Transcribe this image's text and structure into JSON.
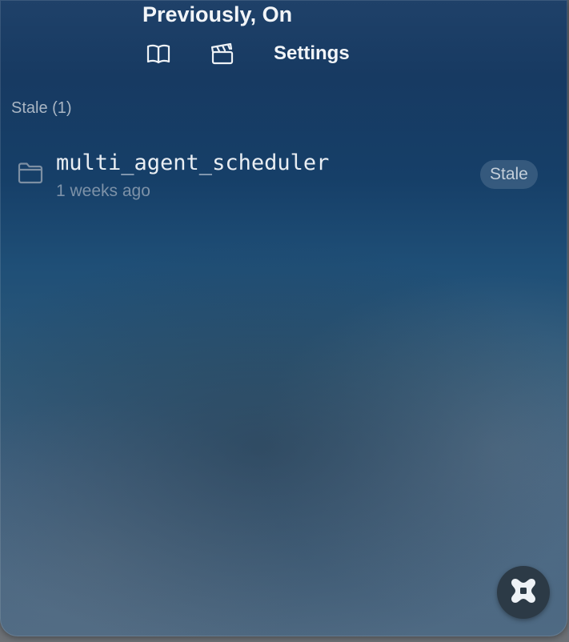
{
  "header": {
    "title": "Previously, On",
    "toolbar": {
      "book_icon": "book-open-icon",
      "clapper_icon": "clapperboard-icon",
      "settings_label": "Settings"
    }
  },
  "section": {
    "label": "Stale (1)"
  },
  "items": [
    {
      "icon": "folder-icon",
      "name": "multi_agent_scheduler",
      "time": "1 weeks ago",
      "badge": "Stale"
    }
  ],
  "fab": {
    "icon": "app-logo-icon"
  },
  "colors": {
    "title_text": "#f2f5f8",
    "section_text": "#aab6c4",
    "item_text": "#e9eef3",
    "muted_text": "#7d92a8",
    "badge_text": "#c4cfda",
    "fab_bg": "#2c3a46"
  }
}
